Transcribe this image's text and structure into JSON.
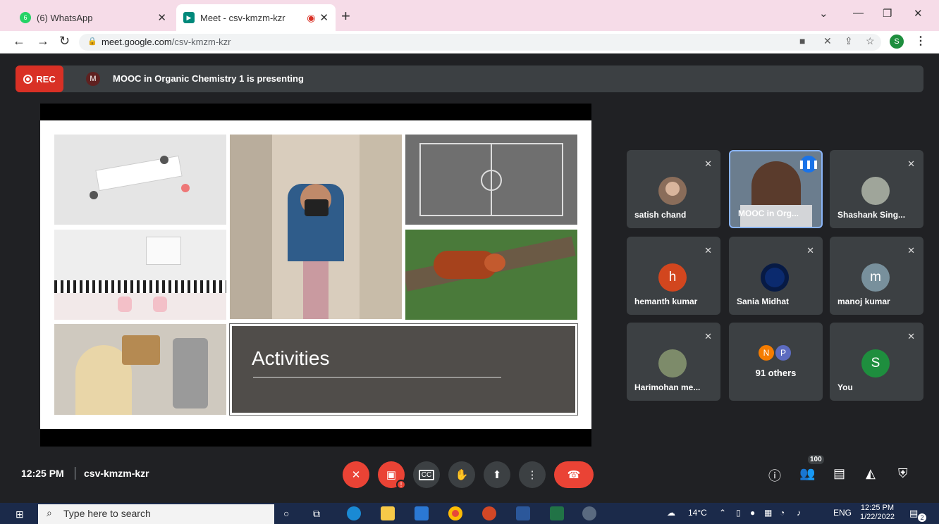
{
  "browser": {
    "tabs": [
      {
        "label": "(6) WhatsApp",
        "favicon": "whatsapp-icon",
        "badge": "6",
        "color": "#25d366"
      },
      {
        "label": "Meet - csv-kmzm-kzr",
        "favicon": "meet-icon",
        "color": "#1a73e8"
      }
    ],
    "url_host": "meet.google.com",
    "url_path": "/csv-kmzm-kzr",
    "profile_initial": "S"
  },
  "presentation": {
    "rec_label": "REC",
    "presenter_initial": "M",
    "presenting_text": "MOOC in Organic Chemistry 1 is presenting",
    "slide_title": "Activities"
  },
  "participants": [
    {
      "name": "satish chand",
      "type": "photo",
      "muted": true
    },
    {
      "name": "MOOC in Org...",
      "type": "video",
      "speaking": true
    },
    {
      "name": "Shashank Sing...",
      "type": "photo",
      "muted": true
    },
    {
      "name": "hemanth kumar",
      "type": "initial",
      "initial": "h",
      "color": "#d2461e",
      "muted": true
    },
    {
      "name": "Sania Midhat",
      "type": "photo",
      "muted": true
    },
    {
      "name": "manoj kumar",
      "type": "initial",
      "initial": "m",
      "color": "#78909c",
      "muted": true
    },
    {
      "name": "Harimohan me...",
      "type": "photo",
      "muted": true
    },
    {
      "name": "91 others",
      "type": "others",
      "initials": [
        "N",
        "P"
      ],
      "colors": [
        "#f57c00",
        "#5c6bc0"
      ]
    },
    {
      "name": "You",
      "type": "initial",
      "initial": "S",
      "color": "#1e8e3e",
      "muted": true
    }
  ],
  "bottom": {
    "time": "12:25 PM",
    "meeting_code": "csv-kmzm-kzr",
    "participant_count": "100"
  },
  "taskbar": {
    "search_placeholder": "Type here to search",
    "weather": "14°C",
    "lang": "ENG",
    "time": "12:25 PM",
    "date": "1/22/2022",
    "notification_count": "2"
  },
  "colors": {
    "accent": "#1a73e8",
    "danger": "#ea4335",
    "surface": "#3c4043"
  }
}
